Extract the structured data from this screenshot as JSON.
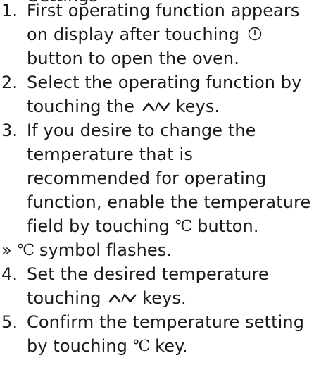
{
  "doc": {
    "top_fragment": "Settings",
    "steps": [
      {
        "number": "1.",
        "lines": [
          {
            "before": "First operating function appears"
          },
          {
            "before": "on display after touching",
            "icon": "power-icon"
          },
          {
            "before": "button to open the oven."
          }
        ]
      },
      {
        "number": "2.",
        "lines": [
          {
            "before": "Select the operating function by"
          },
          {
            "before": "touching the",
            "icon": "up-down-keys-icon",
            "after": "keys."
          }
        ]
      },
      {
        "number": "3.",
        "lines": [
          {
            "before": "If you desire to change the"
          },
          {
            "before": "temperature that is"
          },
          {
            "before": "recommended for operating"
          },
          {
            "before": "function, enable the temperature"
          },
          {
            "before": "field by touching",
            "icon": "celsius-icon",
            "after": "button."
          }
        ]
      },
      {
        "result": true,
        "marker": "»",
        "lines": [
          {
            "icon": "celsius-icon",
            "after": "symbol flashes."
          }
        ]
      },
      {
        "number": "4.",
        "lines": [
          {
            "before": "Set the desired temperature"
          },
          {
            "before": "touching",
            "icon": "up-down-keys-icon",
            "after": "keys."
          }
        ]
      },
      {
        "number": "5.",
        "lines": [
          {
            "before": "Confirm the temperature setting"
          },
          {
            "before": "by touching",
            "icon": "celsius-icon",
            "after": "key."
          }
        ]
      }
    ],
    "celsius_glyph": "℃"
  }
}
